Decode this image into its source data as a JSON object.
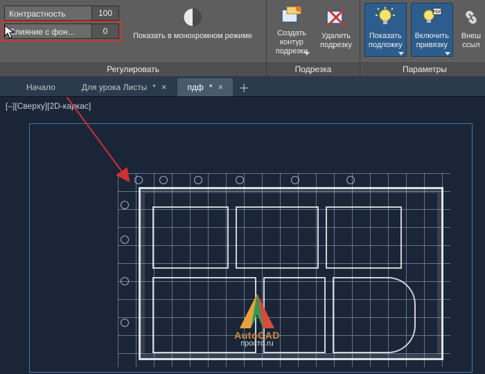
{
  "ribbon": {
    "panels": {
      "adjust": {
        "title": "Регулировать",
        "contrast": {
          "label": "Контрастность",
          "value": "100"
        },
        "fade": {
          "label": "Слияние с фон...",
          "value": "0"
        },
        "mono_btn": "Показать в монохромном режиме"
      },
      "clip": {
        "title": "Подрезка",
        "create": "Создать контур\nподрезки",
        "remove": "Удалить\nподрезку"
      },
      "options": {
        "title": "Параметры",
        "show_underlay": "Показать\nподложку",
        "snap": "Включить\nпривязку",
        "ext_links": "Внеш\nссыл"
      }
    }
  },
  "tabs": {
    "items": [
      {
        "label": "Начало",
        "dirty": ""
      },
      {
        "label": "Для урока Листы",
        "dirty": "*"
      },
      {
        "label": "пдф",
        "dirty": "*"
      }
    ]
  },
  "viewport": {
    "label": "[–][Сверху][2D-каркас]"
  },
  "watermark": {
    "brand": "AutoCAD",
    "site": "просто.ru"
  },
  "icons": {
    "pdf_badge": "PDF"
  }
}
